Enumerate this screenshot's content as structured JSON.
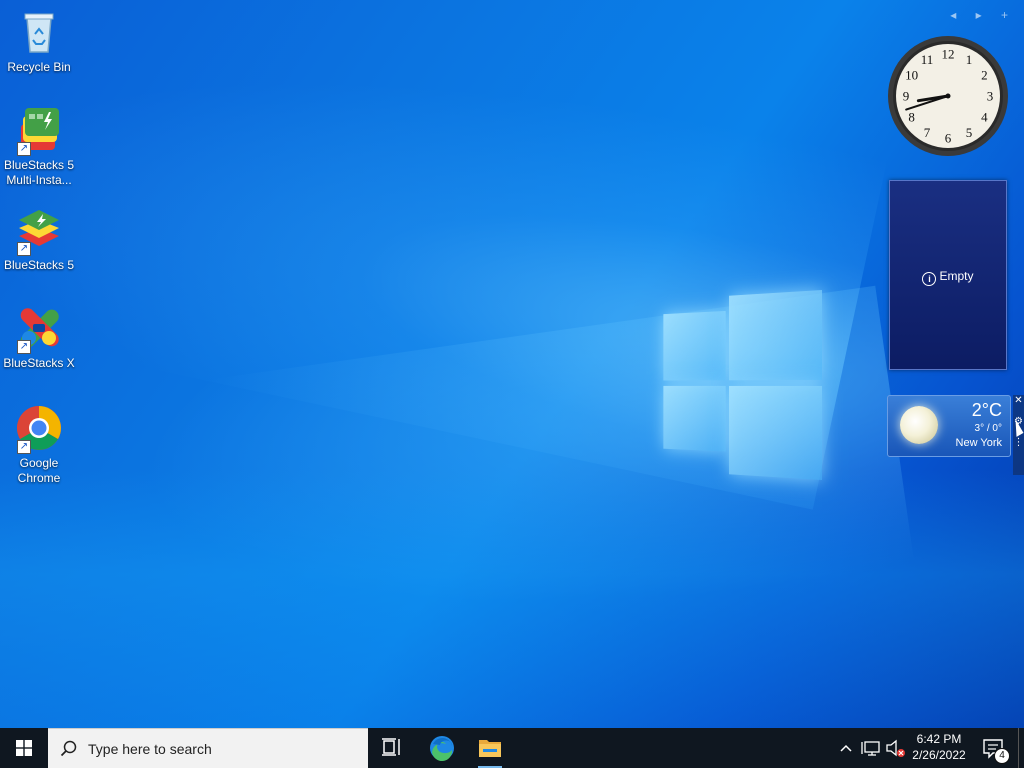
{
  "desktop_icons": [
    {
      "label": "Recycle Bin"
    },
    {
      "label": "BlueStacks 5 Multi-Insta..."
    },
    {
      "label": "BlueStacks 5"
    },
    {
      "label": "BlueStacks X"
    },
    {
      "label": "Google Chrome"
    }
  ],
  "gadgets": {
    "nav": "◂ ▸ +",
    "clock": {
      "hour": 8,
      "minute": 42
    },
    "slideshow": {
      "info_symbol": "i",
      "message": "Empty"
    },
    "weather": {
      "temperature": "2°C",
      "range": "3° / 0°",
      "city": "New York",
      "condition_icon": "moon-icon"
    }
  },
  "taskbar": {
    "search_placeholder": "Type here to search",
    "pinned": [
      "task-view-icon",
      "edge-icon",
      "file-explorer-icon"
    ],
    "tray": {
      "time": "6:42 PM",
      "date": "2/26/2022",
      "notification_count": "4"
    }
  },
  "colors": {
    "taskbar_bg": "#0f1720",
    "search_bg": "#f2f2f2",
    "accent": "#0a82ea"
  }
}
